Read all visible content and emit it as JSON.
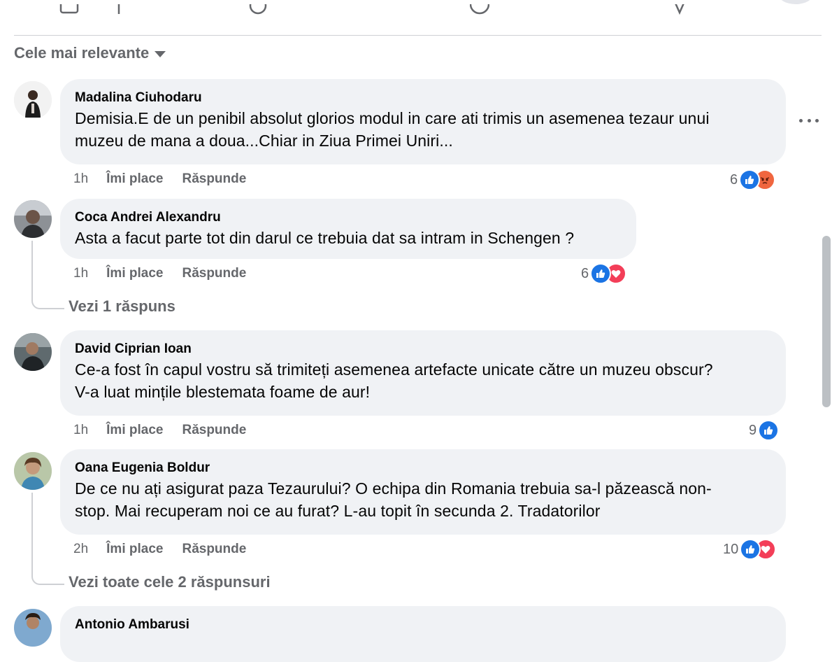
{
  "sort": {
    "label": "Cele mai relevante"
  },
  "icons": {
    "sort_caret": "caret-down-icon",
    "like": "thumbs-up-icon",
    "angry": "angry-face-icon",
    "love": "heart-icon",
    "more": "more-options-icon"
  },
  "colors": {
    "like_blue": "#1b74e4",
    "angry_orange": "#f0663f",
    "love_red": "#f33e58",
    "bubble_bg": "#f0f2f5",
    "meta_gray": "#65676b"
  },
  "comments": [
    {
      "author": "Madalina Ciuhodaru",
      "text_lines": [
        "Demisia.E de un penibil absolut glorios modul in care ati trimis un asemenea tezaur unui",
        "muzeu de mana a doua...Chiar in Ziua Primei Uniri..."
      ],
      "time": "1h",
      "like_label": "Îmi place",
      "reply_label": "Răspunde",
      "reaction_count": "6",
      "reactions": [
        "like",
        "angry"
      ]
    },
    {
      "author": "Coca Andrei Alexandru",
      "text_lines": [
        "Asta a facut parte tot din darul ce trebuia dat sa intram in Schengen ?"
      ],
      "time": "1h",
      "like_label": "Îmi place",
      "reply_label": "Răspunde",
      "reaction_count": "6",
      "reactions": [
        "like",
        "love"
      ],
      "view_replies": "Vezi 1 răspuns"
    },
    {
      "author": "David Ciprian Ioan",
      "text_lines": [
        "Ce-a fost în capul vostru să trimiteți asemenea artefacte unicate către un muzeu obscur?",
        "V-a luat mințile blestemata foame de aur!"
      ],
      "time": "1h",
      "like_label": "Îmi place",
      "reply_label": "Răspunde",
      "reaction_count": "9",
      "reactions": [
        "like"
      ]
    },
    {
      "author": "Oana Eugenia Boldur",
      "text_lines": [
        "De ce nu ați asigurat paza Tezaurului? O echipa din Romania trebuia sa-l păzească non-",
        "stop. Mai recuperam noi ce au furat? L-au topit în secunda 2. Tradatorilor"
      ],
      "time": "2h",
      "like_label": "Îmi place",
      "reply_label": "Răspunde",
      "reaction_count": "10",
      "reactions": [
        "like",
        "love"
      ],
      "view_replies": "Vezi toate cele 2 răspunsuri"
    },
    {
      "author": "Antonio Ambarusi"
    }
  ]
}
